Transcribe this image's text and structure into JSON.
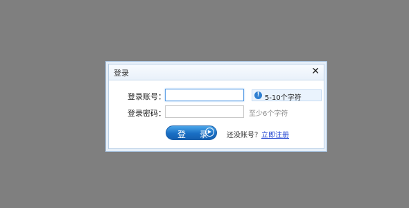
{
  "dialog": {
    "title": "登录",
    "close_glyph": "✕"
  },
  "form": {
    "account_label": "登录账号：",
    "account_value": "",
    "account_tip_icon": "info-icon",
    "account_tip": "5-10个字符",
    "password_label": "登录密码：",
    "password_value": "",
    "password_hint": "至少6个字符"
  },
  "actions": {
    "login_label": "登 录",
    "no_account_text": "还没账号？",
    "register_link": "立即注册"
  },
  "colors": {
    "overlay": "#7f7f7f",
    "accent": "#1a6fc4",
    "link": "#1b3fd0"
  }
}
